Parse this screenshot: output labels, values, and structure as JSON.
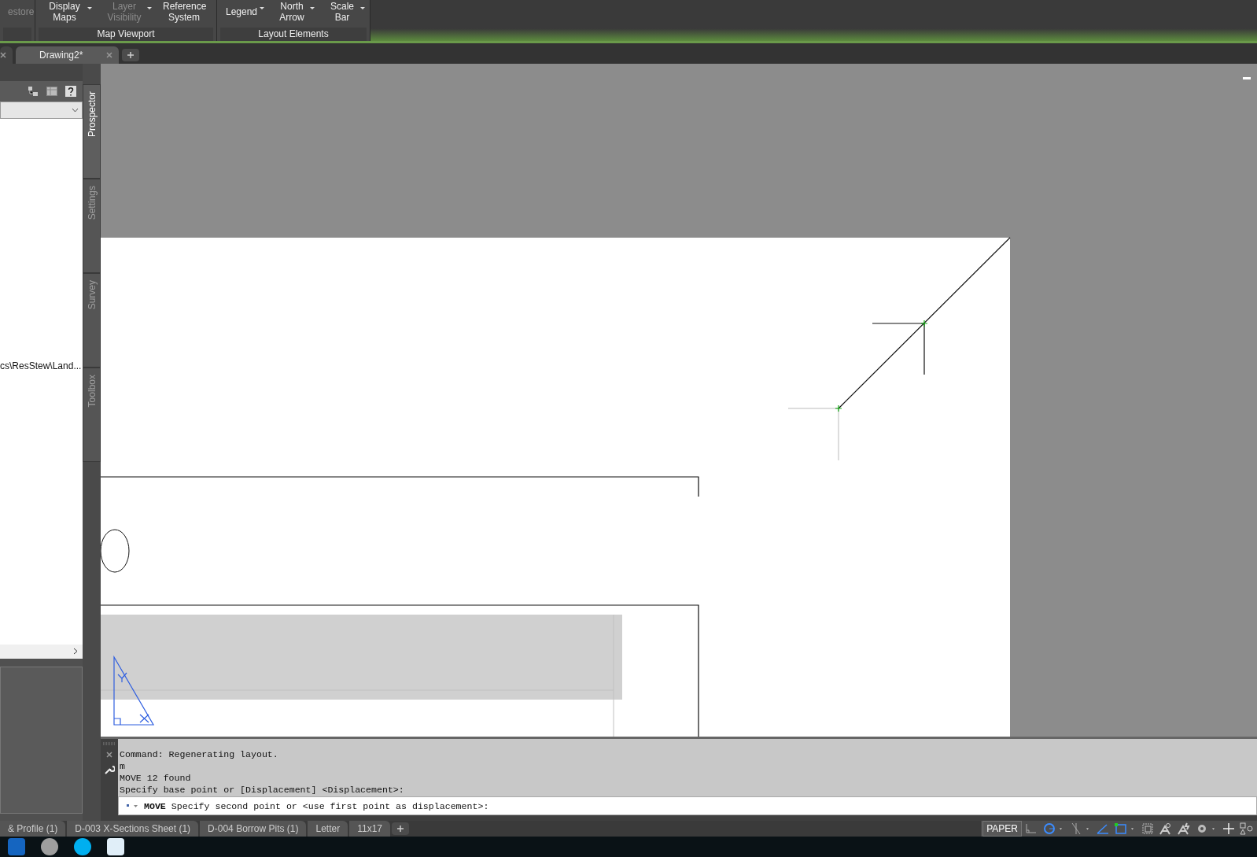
{
  "ribbon": {
    "groups": [
      {
        "buttons": [
          {
            "label": "estore",
            "disabled": true,
            "dropdown": false
          }
        ]
      },
      {
        "title": "Map Viewport",
        "buttons": [
          {
            "label": "Display Maps",
            "disabled": false,
            "dropdown": true
          },
          {
            "label": "Layer Visibility",
            "disabled": true,
            "dropdown": true
          },
          {
            "label": "Reference System",
            "disabled": false,
            "dropdown": false
          }
        ]
      },
      {
        "title": "Layout Elements",
        "buttons": [
          {
            "label": "Legend",
            "disabled": false,
            "dropdown": true
          },
          {
            "label": "North Arrow",
            "disabled": false,
            "dropdown": true
          },
          {
            "label": "Scale Bar",
            "disabled": false,
            "dropdown": true
          }
        ]
      }
    ]
  },
  "document_tabs": [
    {
      "selected": false
    },
    {
      "label": "Drawing2*",
      "selected": true
    }
  ],
  "side_panel": {
    "path_text": "cs\\ResStew\\Land...",
    "vertical_tabs": [
      {
        "label": "Prospector",
        "selected": true
      },
      {
        "label": "Settings",
        "selected": false
      },
      {
        "label": "Survey",
        "selected": false
      },
      {
        "label": "Toolbox",
        "selected": false
      }
    ]
  },
  "command_line": {
    "history": [
      "Command: Regenerating layout.",
      "m",
      "MOVE 12 found",
      "Specify base point or [Displacement] <Displacement>:"
    ],
    "prompt_command": "MOVE",
    "prompt_text": "Specify second point or <use first point as displacement>:"
  },
  "layout_tabs": [
    {
      "label": "& Profile (1)"
    },
    {
      "label": "D-003 X-Sections Sheet (1)"
    },
    {
      "label": "D-004 Borrow Pits (1)"
    },
    {
      "label": "Letter"
    },
    {
      "label": "11x17"
    }
  ],
  "status_bar": {
    "space_label": "PAPER",
    "toggles": [
      {
        "kind": "ortho",
        "on": false
      },
      {
        "kind": "polar",
        "on": true
      },
      {
        "kind": "isodraft",
        "on": false
      },
      {
        "kind": "angle",
        "on": true
      },
      {
        "kind": "snap",
        "on": true
      }
    ]
  }
}
